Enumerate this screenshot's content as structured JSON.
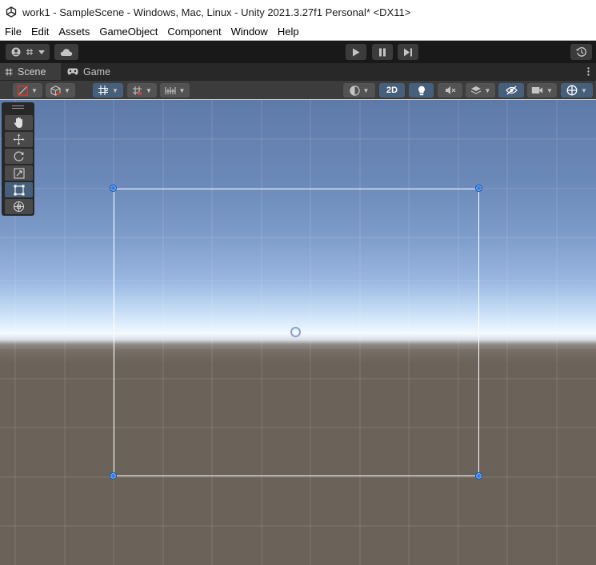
{
  "window": {
    "title": "work1 - SampleScene - Windows, Mac, Linux - Unity 2021.3.27f1 Personal* <DX11>",
    "app_icon": "unity-logo-icon"
  },
  "menu": {
    "items": [
      "File",
      "Edit",
      "Assets",
      "GameObject",
      "Component",
      "Window",
      "Help"
    ]
  },
  "main_toolbar": {
    "account_icon": "account-icon",
    "layers_icon": "layers-icon",
    "cloud_icon": "cloud-icon",
    "play_icon": "play-icon",
    "pause_icon": "pause-icon",
    "step_icon": "step-icon",
    "history_icon": "history-icon"
  },
  "tabs": {
    "scene": "Scene",
    "game": "Game",
    "menu_icon": "kebab-menu-icon"
  },
  "scene_toolbar": {
    "twod_label": "2D"
  },
  "tools": [
    "hand-tool",
    "move-tool",
    "rotate-tool",
    "scale-tool",
    "rect-tool",
    "transform-tool"
  ],
  "active_tool": "rect-tool",
  "colors": {
    "active_blue": "#46607c",
    "gizmo_handle": "#2f7fe8",
    "toolbar_dark": "#191919",
    "panel": "#3c3c3c"
  }
}
